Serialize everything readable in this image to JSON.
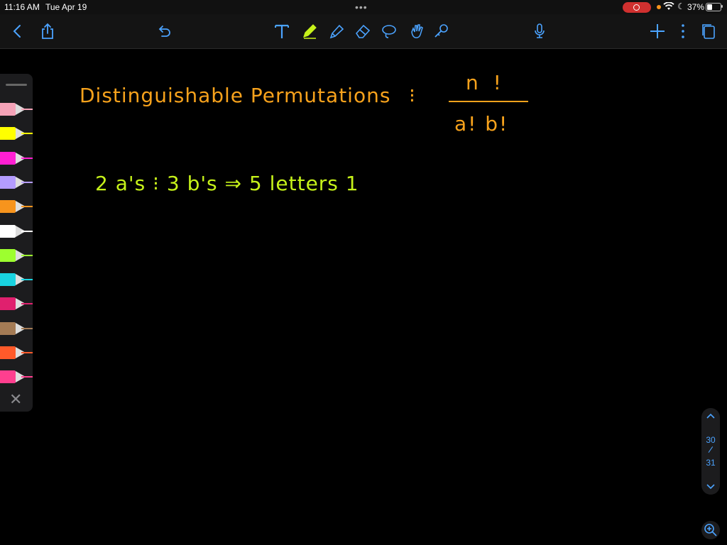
{
  "status_bar": {
    "time": "11:16 AM",
    "date": "Tue Apr 19",
    "battery_percent": "37%",
    "battery_level": 0.37
  },
  "toolbar": {
    "left_icons": [
      "back-chevron-icon",
      "share-icon",
      "undo-icon"
    ],
    "tool_icons": [
      "text-tool-icon",
      "pen-tool-icon",
      "highlighter-icon",
      "eraser-icon",
      "lasso-icon",
      "hand-tool-icon",
      "laser-pointer-icon"
    ],
    "right_icons": [
      "microphone-icon",
      "add-page-icon",
      "more-options-icon",
      "pages-icon"
    ],
    "accent_color": "#4ba3ff"
  },
  "pen_tray": {
    "pens": [
      {
        "color": "#f5a3b8"
      },
      {
        "color": "#ffff00"
      },
      {
        "color": "#ff1fd2"
      },
      {
        "color": "#b49cff"
      },
      {
        "color": "#f7941d"
      },
      {
        "color": "#ffffff"
      },
      {
        "color": "#9dff2f"
      },
      {
        "color": "#19d3e0"
      },
      {
        "color": "#e0206e"
      },
      {
        "color": "#a47b55"
      },
      {
        "color": "#ff5a2a"
      },
      {
        "color": "#ff3f8f"
      }
    ]
  },
  "page_scroller": {
    "current_page": "30",
    "total_pages": "31"
  },
  "canvas": {
    "title": "Distinguishable Permutations",
    "colon": "⁝",
    "numerator": "n !",
    "denominator": "a! b!",
    "line2": "2 a's  ⁝  3 b's  ⇒ 5 letters  1",
    "ink_orange": "#f7a21c",
    "ink_green": "#c6f21a"
  }
}
